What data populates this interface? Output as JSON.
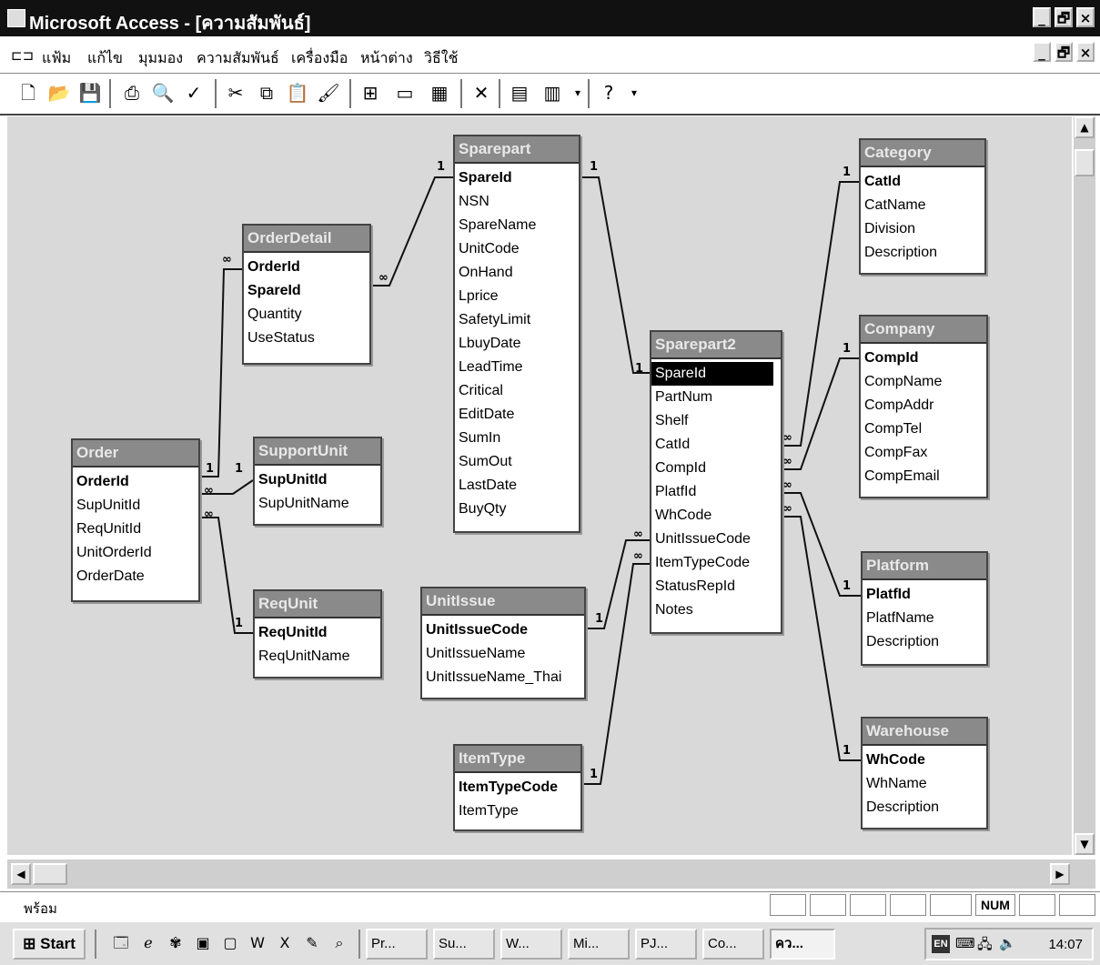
{
  "window": {
    "title": "Microsoft Access - [ความสัมพันธ์]",
    "controls": {
      "minimize": "_",
      "restore": "🗗",
      "close": "×"
    }
  },
  "menubar": {
    "items": [
      "แฟ้ม",
      "แก้ไข",
      "มุมมอง",
      "ความสัมพันธ์",
      "เครื่องมือ",
      "หน้าต่าง",
      "วิธีใช้"
    ]
  },
  "toolbar": {
    "icons": [
      "new-icon",
      "open-icon",
      "save-icon",
      "print-icon",
      "print-preview-icon",
      "spelling-icon",
      "cut-icon",
      "copy-icon",
      "paste-icon",
      "format-painter-icon",
      "show-table-icon",
      "show-direct-icon",
      "show-all-icon",
      "delete-icon",
      "database-window-icon",
      "new-object-icon",
      "help-icon"
    ]
  },
  "tables": {
    "sparepart": {
      "title": "Sparepart",
      "fields": [
        "SpareId",
        "NSN",
        "SpareName",
        "UnitCode",
        "OnHand",
        "Lprice",
        "SafetyLimit",
        "LbuyDate",
        "LeadTime",
        "Critical",
        "EditDate",
        "SumIn",
        "SumOut",
        "LastDate",
        "BuyQty"
      ]
    },
    "category": {
      "title": "Category",
      "fields": [
        "CatId",
        "CatName",
        "Division",
        "Description"
      ]
    },
    "orderdetail": {
      "title": "OrderDetail",
      "fields": [
        "OrderId",
        "SpareId",
        "Quantity",
        "UseStatus"
      ]
    },
    "company": {
      "title": "Company",
      "fields": [
        "CompId",
        "CompName",
        "CompAddr",
        "CompTel",
        "CompFax",
        "CompEmail"
      ]
    },
    "sparepart2": {
      "title": "Sparepart2",
      "fields": [
        "SpareId",
        "PartNum",
        "Shelf",
        "CatId",
        "CompId",
        "PlatfId",
        "WhCode",
        "UnitIssueCode",
        "ItemTypeCode",
        "StatusRepId",
        "Notes"
      ]
    },
    "order": {
      "title": "Order",
      "fields": [
        "OrderId",
        "SupUnitId",
        "ReqUnitId",
        "UnitOrderId",
        "OrderDate"
      ]
    },
    "supportunit": {
      "title": "SupportUnit",
      "fields": [
        "SupUnitId",
        "SupUnitName"
      ]
    },
    "platform": {
      "title": "Platform",
      "fields": [
        "PlatfId",
        "PlatfName",
        "Description"
      ]
    },
    "requnit": {
      "title": "ReqUnit",
      "fields": [
        "ReqUnitId",
        "ReqUnitName"
      ]
    },
    "unitissue": {
      "title": "UnitIssue",
      "fields": [
        "UnitIssueCode",
        "UnitIssueName",
        "UnitIssueName_Thai"
      ]
    },
    "warehouse": {
      "title": "Warehouse",
      "fields": [
        "WhCode",
        "WhName",
        "Description"
      ]
    },
    "itemtype": {
      "title": "ItemType",
      "fields": [
        "ItemTypeCode",
        "ItemType"
      ]
    }
  },
  "relationship_marks": {
    "one": "1",
    "many": "∞"
  },
  "statusbar": {
    "text": "พร้อม",
    "num_indicator": "NUM"
  },
  "taskbar": {
    "start_label": "Start",
    "tasks": [
      "Pr...",
      "Su...",
      "W...",
      "Mi...",
      "PJ...",
      "Co...",
      "คว..."
    ],
    "tray_lang": "EN",
    "clock": "14:07"
  }
}
